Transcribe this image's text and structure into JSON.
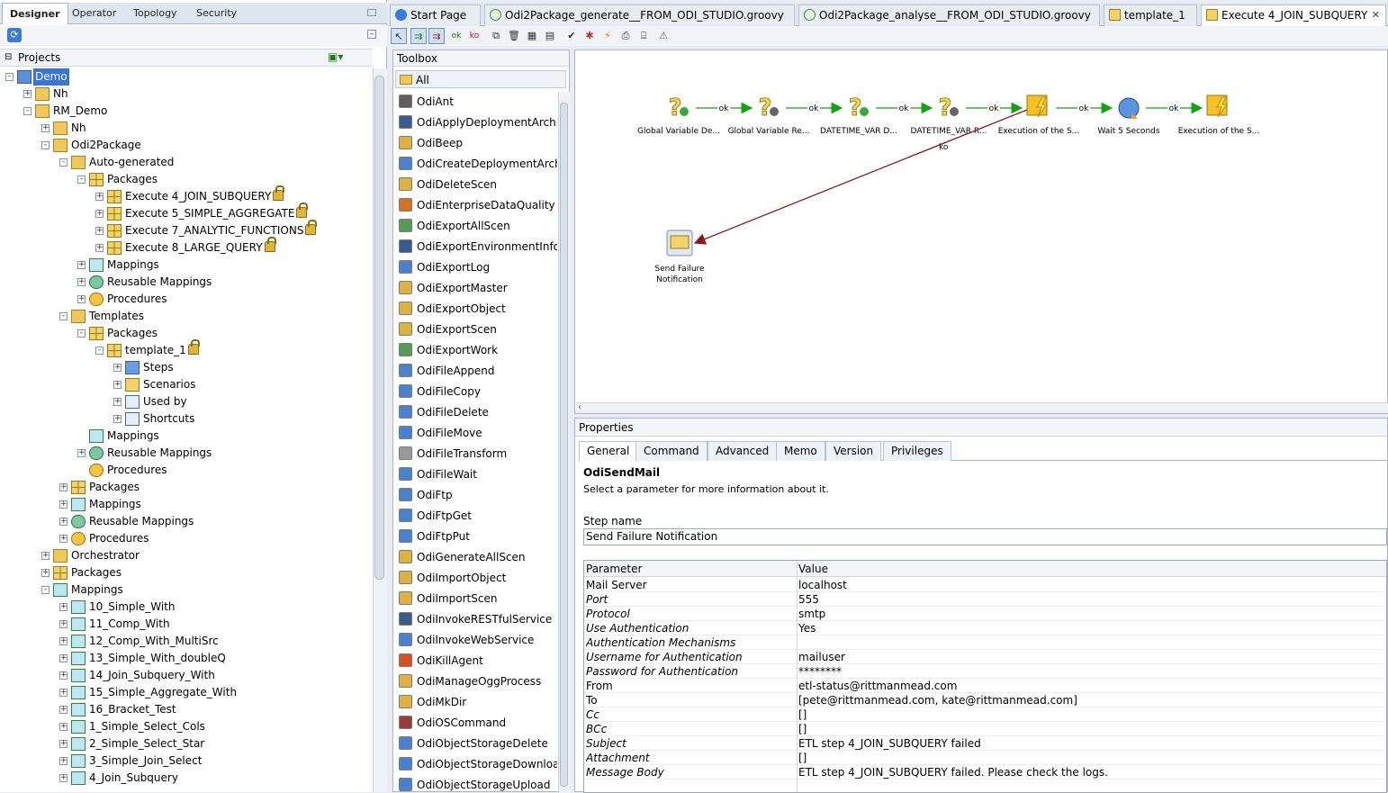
{
  "left_tabs": [
    "Designer",
    "Operator",
    "Topology",
    "Security"
  ],
  "projects_label": "Projects",
  "tree": [
    {
      "label": "Demo",
      "depth": 0,
      "exp": "-",
      "icon": "project",
      "sel": true
    },
    {
      "label": "Nh",
      "depth": 1,
      "exp": "+",
      "icon": "folder"
    },
    {
      "label": "RM_Demo",
      "depth": 1,
      "exp": "-",
      "icon": "folder"
    },
    {
      "label": "Nh",
      "depth": 2,
      "exp": "+",
      "icon": "folder"
    },
    {
      "label": "Odi2Package",
      "depth": 2,
      "exp": "-",
      "icon": "folder"
    },
    {
      "label": "Auto-generated",
      "depth": 3,
      "exp": "-",
      "icon": "folder"
    },
    {
      "label": "Packages",
      "depth": 4,
      "exp": "-",
      "icon": "package"
    },
    {
      "label": "Execute 4_JOIN_SUBQUERY",
      "depth": 5,
      "exp": "+",
      "icon": "package",
      "lock": true
    },
    {
      "label": "Execute 5_SIMPLE_AGGREGATE",
      "depth": 5,
      "exp": "+",
      "icon": "package",
      "lock": true
    },
    {
      "label": "Execute 7_ANALYTIC_FUNCTIONS",
      "depth": 5,
      "exp": "+",
      "icon": "package",
      "lock": true
    },
    {
      "label": "Execute 8_LARGE_QUERY",
      "depth": 5,
      "exp": "+",
      "icon": "package",
      "lock": true
    },
    {
      "label": "Mappings",
      "depth": 4,
      "exp": "+",
      "icon": "mapping"
    },
    {
      "label": "Reusable Mappings",
      "depth": 4,
      "exp": "+",
      "icon": "reusable"
    },
    {
      "label": "Procedures",
      "depth": 4,
      "exp": "+",
      "icon": "procedure"
    },
    {
      "label": "Templates",
      "depth": 3,
      "exp": "-",
      "icon": "folder"
    },
    {
      "label": "Packages",
      "depth": 4,
      "exp": "-",
      "icon": "package"
    },
    {
      "label": "template_1",
      "depth": 5,
      "exp": "-",
      "icon": "package",
      "lock": true
    },
    {
      "label": "Steps",
      "depth": 6,
      "exp": "+",
      "icon": "steps"
    },
    {
      "label": "Scenarios",
      "depth": 6,
      "exp": "+",
      "icon": "scenario"
    },
    {
      "label": "Used by",
      "depth": 6,
      "exp": "+",
      "icon": "usedby"
    },
    {
      "label": "Shortcuts",
      "depth": 6,
      "exp": "+",
      "icon": "usedby"
    },
    {
      "label": "Mappings",
      "depth": 4,
      "exp": "",
      "icon": "mapping"
    },
    {
      "label": "Reusable Mappings",
      "depth": 4,
      "exp": "+",
      "icon": "reusable"
    },
    {
      "label": "Procedures",
      "depth": 4,
      "exp": "",
      "icon": "procedure"
    },
    {
      "label": "Packages",
      "depth": 3,
      "exp": "+",
      "icon": "package"
    },
    {
      "label": "Mappings",
      "depth": 3,
      "exp": "+",
      "icon": "mapping"
    },
    {
      "label": "Reusable Mappings",
      "depth": 3,
      "exp": "+",
      "icon": "reusable"
    },
    {
      "label": "Procedures",
      "depth": 3,
      "exp": "+",
      "icon": "procedure"
    },
    {
      "label": "Orchestrator",
      "depth": 2,
      "exp": "+",
      "icon": "folder"
    },
    {
      "label": "Packages",
      "depth": 2,
      "exp": "+",
      "icon": "package"
    },
    {
      "label": "Mappings",
      "depth": 2,
      "exp": "-",
      "icon": "mapping"
    },
    {
      "label": "10_Simple_With",
      "depth": 3,
      "exp": "+",
      "icon": "mapping"
    },
    {
      "label": "11_Comp_With",
      "depth": 3,
      "exp": "+",
      "icon": "mapping"
    },
    {
      "label": "12_Comp_With_MultiSrc",
      "depth": 3,
      "exp": "+",
      "icon": "mapping"
    },
    {
      "label": "13_Simple_With_doubleQ",
      "depth": 3,
      "exp": "+",
      "icon": "mapping"
    },
    {
      "label": "14_Join_Subquery_With",
      "depth": 3,
      "exp": "+",
      "icon": "mapping"
    },
    {
      "label": "15_Simple_Aggregate_With",
      "depth": 3,
      "exp": "+",
      "icon": "mapping"
    },
    {
      "label": "16_Bracket_Test",
      "depth": 3,
      "exp": "+",
      "icon": "mapping"
    },
    {
      "label": "1_Simple_Select_Cols",
      "depth": 3,
      "exp": "+",
      "icon": "mapping"
    },
    {
      "label": "2_Simple_Select_Star",
      "depth": 3,
      "exp": "+",
      "icon": "mapping"
    },
    {
      "label": "3_Simple_Join_Select",
      "depth": 3,
      "exp": "+",
      "icon": "mapping"
    },
    {
      "label": "4_Join_Subquery",
      "depth": 3,
      "exp": "+",
      "icon": "mapping"
    }
  ],
  "doc_tabs": [
    {
      "label": "Start Page",
      "icon": "start"
    },
    {
      "label": "Odi2Package_generate__FROM_ODI_STUDIO.groovy",
      "icon": "groovy"
    },
    {
      "label": "Odi2Package_analyse__FROM_ODI_STUDIO.groovy",
      "icon": "groovy"
    },
    {
      "label": "template_1",
      "icon": "package"
    },
    {
      "label": "Execute 4_JOIN_SUBQUERY",
      "icon": "package",
      "active": true,
      "close": "✕"
    }
  ],
  "toolbox": {
    "title": "Toolbox",
    "all_label": "All",
    "items": [
      "OdiAnt",
      "OdiApplyDeploymentArchive",
      "OdiBeep",
      "OdiCreateDeploymentArchive",
      "OdiDeleteScen",
      "OdiEnterpriseDataQuality",
      "OdiExportAllScen",
      "OdiExportEnvironmentInformation",
      "OdiExportLog",
      "OdiExportMaster",
      "OdiExportObject",
      "OdiExportScen",
      "OdiExportWork",
      "OdiFileAppend",
      "OdiFileCopy",
      "OdiFileDelete",
      "OdiFileMove",
      "OdiFileTransform",
      "OdiFileWait",
      "OdiFtp",
      "OdiFtpGet",
      "OdiFtpPut",
      "OdiGenerateAllScen",
      "OdiImportObject",
      "OdiImportScen",
      "OdiInvokeRESTfulService",
      "OdiInvokeWebService",
      "OdiKillAgent",
      "OdiManageOggProcess",
      "OdiMkDir",
      "OdiOSCommand",
      "OdiObjectStorageDelete",
      "OdiObjectStorageDownload",
      "OdiObjectStorageUpload"
    ]
  },
  "diagram": {
    "nodes": [
      {
        "label": "Global Variable De...",
        "kind": "variable"
      },
      {
        "label": "Global Variable Re...",
        "kind": "variable-refresh"
      },
      {
        "label": "DATETIME_VAR D...",
        "kind": "variable"
      },
      {
        "label": "DATETIME_VAR R...",
        "kind": "variable-refresh"
      },
      {
        "label": "Execution of the S...",
        "kind": "scenario"
      },
      {
        "label": "Wait 5 Seconds",
        "kind": "wait"
      },
      {
        "label": "Execution of the S...",
        "kind": "scenario"
      }
    ],
    "ok_label": "ok",
    "ko_label": "ko",
    "failure_node": [
      "Send Failure",
      "Notification"
    ],
    "ok_color": "#1a9e1a",
    "ko_color": "#8b1a1a"
  },
  "properties": {
    "title": "Properties",
    "tabs": [
      "General",
      "Command",
      "Advanced",
      "Memo",
      "Version",
      "Privileges"
    ],
    "tool_name": "OdiSendMail",
    "description": "Select a parameter for more information about it.",
    "step_name_label": "Step name",
    "step_name_value": "Send Failure Notification",
    "col_param": "Parameter",
    "col_value": "Value",
    "rows": [
      {
        "k": "Mail Server",
        "v": "localhost",
        "opt": false
      },
      {
        "k": "Port",
        "v": "555",
        "opt": true
      },
      {
        "k": "Protocol",
        "v": "smtp",
        "opt": true
      },
      {
        "k": "Use Authentication",
        "v": "Yes",
        "opt": true
      },
      {
        "k": "Authentication Mechanisms",
        "v": "",
        "opt": true
      },
      {
        "k": "Username for Authentication",
        "v": "mailuser",
        "opt": true
      },
      {
        "k": "Password for Authentication",
        "v": "********",
        "opt": true
      },
      {
        "k": "From",
        "v": "etl-status@rittmanmead.com",
        "opt": false
      },
      {
        "k": "To",
        "v": "[pete@rittmanmead.com, kate@rittmanmead.com]",
        "opt": false
      },
      {
        "k": "Cc",
        "v": "[]",
        "opt": true
      },
      {
        "k": "BCc",
        "v": "[]",
        "opt": true
      },
      {
        "k": "Subject",
        "v": "ETL step 4_JOIN_SUBQUERY failed",
        "opt": true
      },
      {
        "k": "Attachment",
        "v": "[]",
        "opt": true
      },
      {
        "k": "Message Body",
        "v": "ETL step 4_JOIN_SUBQUERY failed. Please check the logs.",
        "opt": true
      }
    ]
  }
}
